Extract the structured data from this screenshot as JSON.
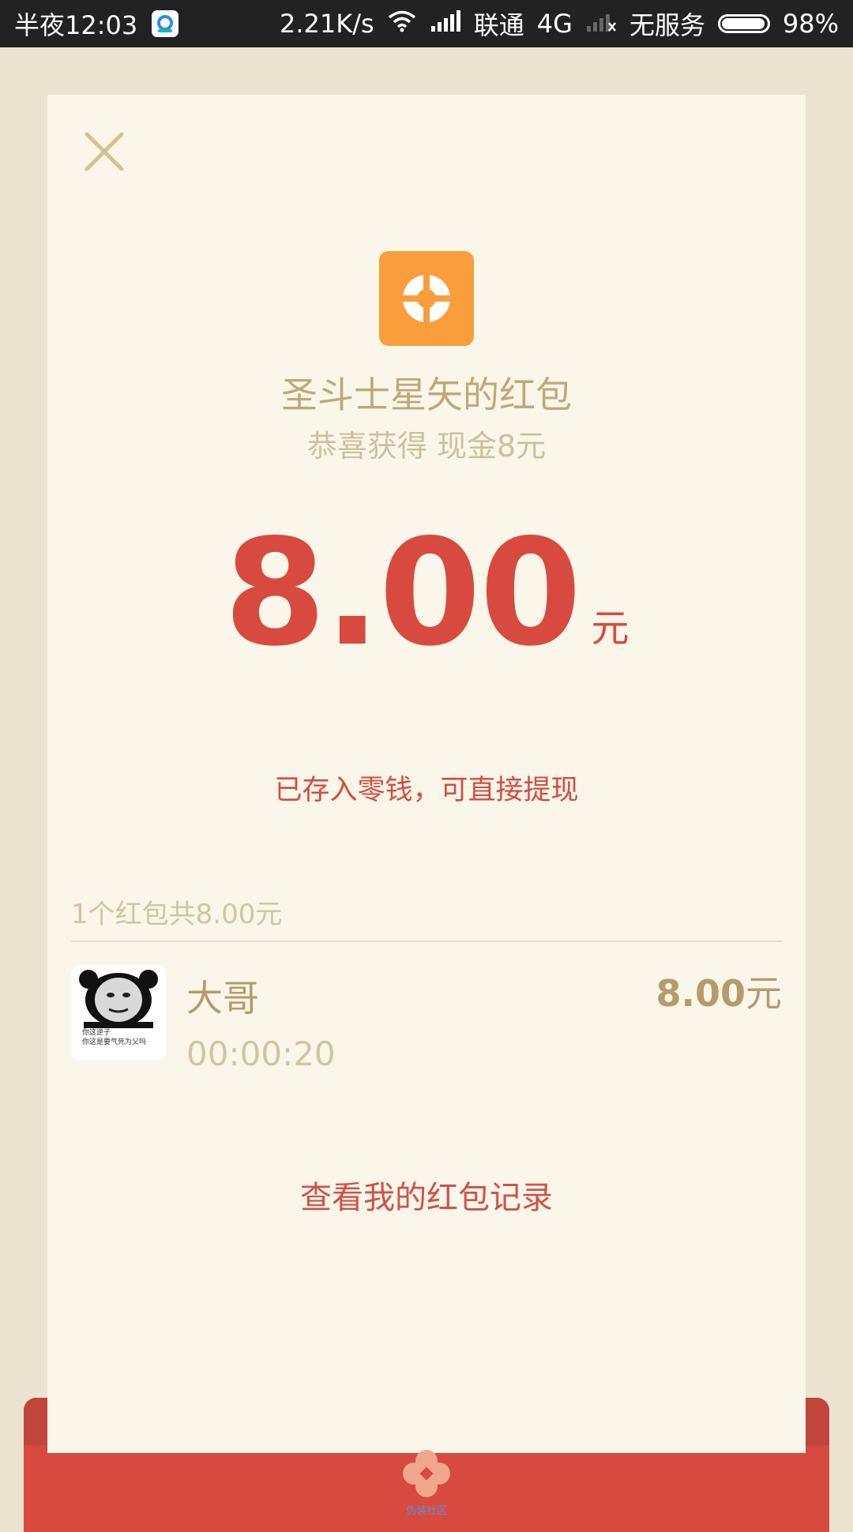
{
  "status_bar": {
    "time": "半夜12:03",
    "network_speed": "2.21K/s",
    "carrier": "联通",
    "network_type": "4G",
    "no_service": "无服务",
    "battery": "98%"
  },
  "card": {
    "sender_title": "圣斗士星矢的红包",
    "greeting": "恭喜获得 现金8元",
    "amount": "8.00",
    "amount_unit": "元",
    "deposit_note": "已存入零钱，可直接提现",
    "summary": "1个红包共8.00元",
    "recipient": {
      "name": "大哥",
      "time": "00:00:20",
      "amount": "8.00",
      "amount_unit": "元",
      "avatar_caption_1": "你这逆子",
      "avatar_caption_2": "你这是要气死为父吗"
    },
    "history_link": "查看我的红包记录"
  },
  "envelope": {
    "logo_label": "伪装社区"
  },
  "colors": {
    "background": "#ece3d0",
    "card": "#faf6ea",
    "accent_red": "#d84a3f",
    "gold_text": "#c0a878",
    "app_orange": "#fa9d3b"
  }
}
